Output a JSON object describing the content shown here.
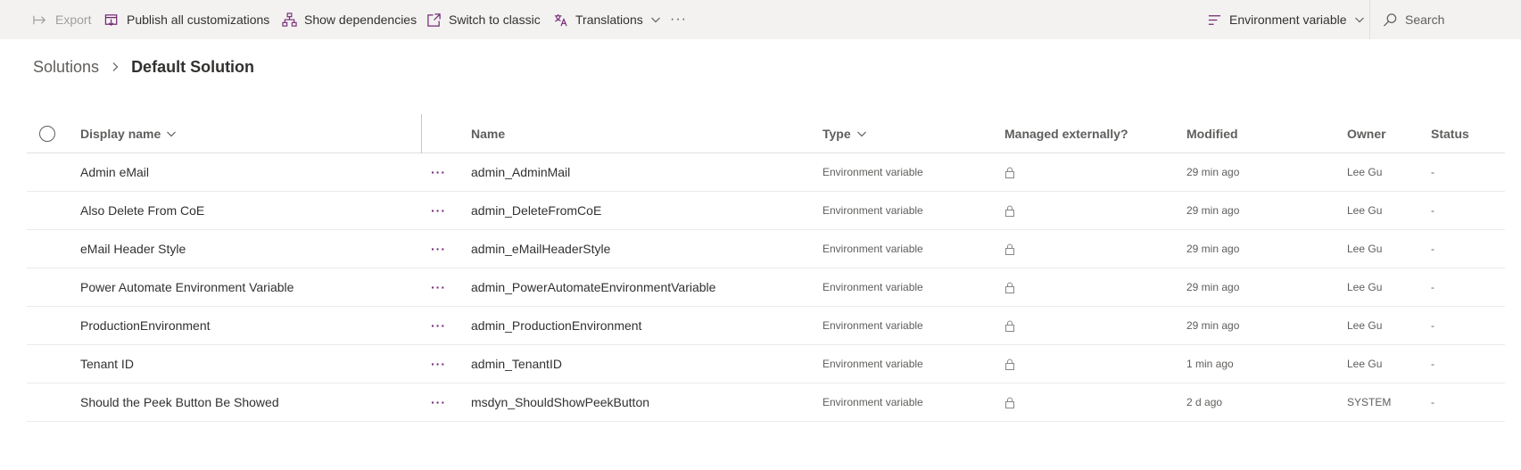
{
  "commandbar": {
    "export_label": "Export",
    "publish_label": "Publish all customizations",
    "dependencies_label": "Show dependencies",
    "classic_label": "Switch to classic",
    "translations_label": "Translations",
    "more_label": "···",
    "filter_label": "Environment variable",
    "search_label": "Search"
  },
  "breadcrumb": {
    "parent": "Solutions",
    "current": "Default Solution"
  },
  "table": {
    "headers": {
      "display_name": "Display name",
      "name": "Name",
      "type": "Type",
      "managed": "Managed externally?",
      "modified": "Modified",
      "owner": "Owner",
      "status": "Status"
    },
    "row_more": "···",
    "rows": [
      {
        "display": "Admin eMail",
        "name": "admin_AdminMail",
        "type": "Environment variable",
        "modified": "29 min ago",
        "owner": "Lee Gu",
        "status": "-"
      },
      {
        "display": "Also Delete From CoE",
        "name": "admin_DeleteFromCoE",
        "type": "Environment variable",
        "modified": "29 min ago",
        "owner": "Lee Gu",
        "status": "-"
      },
      {
        "display": "eMail Header Style",
        "name": "admin_eMailHeaderStyle",
        "type": "Environment variable",
        "modified": "29 min ago",
        "owner": "Lee Gu",
        "status": "-"
      },
      {
        "display": "Power Automate Environment Variable",
        "name": "admin_PowerAutomateEnvironmentVariable",
        "type": "Environment variable",
        "modified": "29 min ago",
        "owner": "Lee Gu",
        "status": "-"
      },
      {
        "display": "ProductionEnvironment",
        "name": "admin_ProductionEnvironment",
        "type": "Environment variable",
        "modified": "29 min ago",
        "owner": "Lee Gu",
        "status": "-"
      },
      {
        "display": "Tenant ID",
        "name": "admin_TenantID",
        "type": "Environment variable",
        "modified": "1 min ago",
        "owner": "Lee Gu",
        "status": "-"
      },
      {
        "display": "Should the Peek Button Be Showed",
        "name": "msdyn_ShouldShowPeekButton",
        "type": "Environment variable",
        "modified": "2 d ago",
        "owner": "SYSTEM",
        "status": "-"
      }
    ]
  },
  "colors": {
    "accent": "#742774",
    "commandbar_bg": "#f3f2f1",
    "text": "#323130",
    "muted": "#605e5c"
  },
  "icons": {
    "export": "export-icon",
    "publish": "publish-icon",
    "dependencies": "dependencies-icon",
    "classic": "switch-classic-icon",
    "translations": "translations-icon",
    "filter": "filter-lines-icon",
    "search": "search-icon",
    "lock": "lock-icon"
  }
}
